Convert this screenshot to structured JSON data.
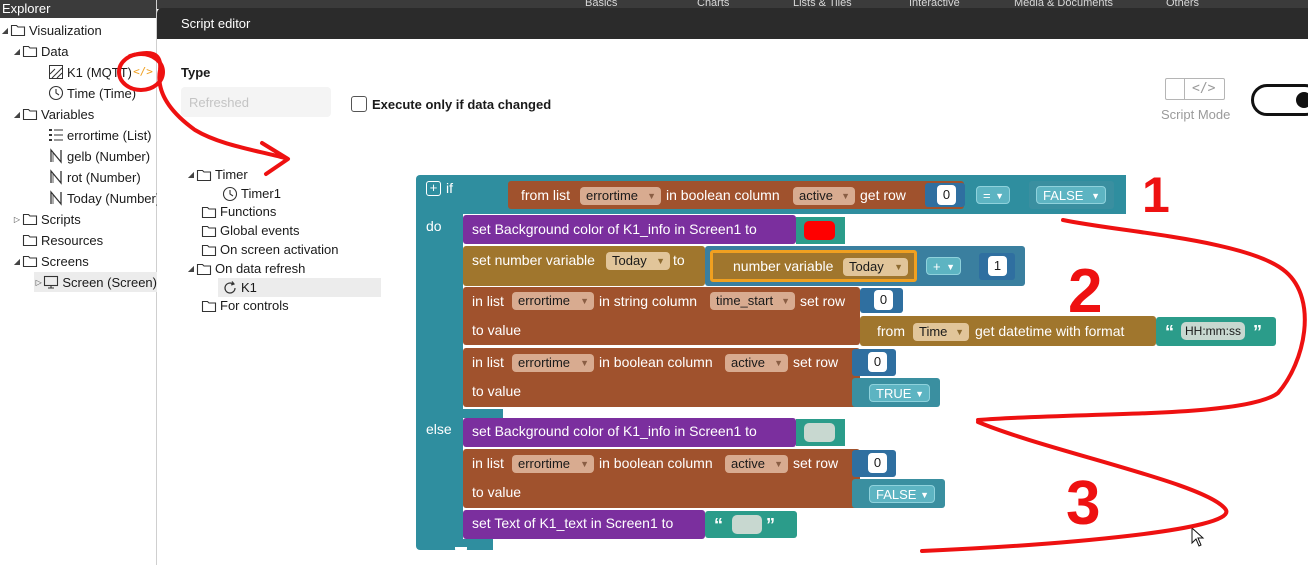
{
  "explorer": {
    "title": "Explorer",
    "items": [
      {
        "label": "Visualization"
      },
      {
        "label": "Data"
      },
      {
        "label": "K1 (MQTT)"
      },
      {
        "label": "Time (Time)"
      },
      {
        "label": "Variables"
      },
      {
        "label": "errortime (List)"
      },
      {
        "label": "gelb (Number)"
      },
      {
        "label": "rot (Number)"
      },
      {
        "label": "Today (Number)"
      },
      {
        "label": "Scripts"
      },
      {
        "label": "Resources"
      },
      {
        "label": "Screens"
      },
      {
        "label": "Screen (Screen)"
      }
    ]
  },
  "top_tabs": [
    "Basics",
    "Charts",
    "Lists & Tiles",
    "Interactive",
    "Media & Documents",
    "Others"
  ],
  "editor": {
    "title": "Script editor",
    "type_label": "Type",
    "type_value": "Refreshed",
    "checkbox_label": "Execute only if data changed",
    "checkbox_checked": false,
    "script_mode_label": "Script Mode",
    "script_mode_icon": "</>",
    "script_mode_on": true
  },
  "events": [
    {
      "label": "Timer"
    },
    {
      "label": "Timer1"
    },
    {
      "label": "Functions"
    },
    {
      "label": "Global events"
    },
    {
      "label": "On screen activation"
    },
    {
      "label": "On data refresh"
    },
    {
      "label": "K1"
    },
    {
      "label": "For controls"
    }
  ],
  "blocks": {
    "if_label": "if",
    "do_label": "do",
    "else_label": "else",
    "condition": {
      "from_list": "from list",
      "list": "errortime",
      "in_boolean_column": "in boolean column",
      "column": "active",
      "get_row": "get row",
      "row": "0",
      "operator": "=",
      "compare": "FALSE"
    },
    "do1": {
      "text": "set Background color of K1_info in Screen1 to",
      "color": "#ff0000"
    },
    "do2": {
      "prefix": "set number variable",
      "variable": "Today",
      "to": "to",
      "inner_prefix": "number variable",
      "inner_variable": "Today",
      "operator": "+",
      "amount": "1"
    },
    "do3": {
      "in_list": "in list",
      "list": "errortime",
      "in_string_column": "in string column",
      "column": "time_start",
      "set_row": "set row",
      "row": "0",
      "to_value": "to value",
      "from": "from",
      "source": "Time",
      "get_datetime": "get datetime with format",
      "format": "HH:mm:ss"
    },
    "do4": {
      "in_list": "in list",
      "list": "errortime",
      "in_boolean_column": "in boolean column",
      "column": "active",
      "set_row": "set row",
      "row": "0",
      "to_value": "to value",
      "value": "TRUE"
    },
    "else1": {
      "text": "set Background color of K1_info in Screen1 to",
      "color": "#c8d8d0"
    },
    "else2": {
      "in_list": "in list",
      "list": "errortime",
      "in_boolean_column": "in boolean column",
      "column": "active",
      "set_row": "set row",
      "row": "0",
      "to_value": "to value",
      "value": "FALSE"
    },
    "else3": {
      "text": "set Text of K1_text in Screen1 to",
      "value": ""
    }
  },
  "annotations": {
    "numbers": [
      "1",
      "2",
      "3"
    ],
    "color": "#ee1111"
  },
  "colors": {
    "control": "#2f8e9f",
    "list": "#a0522d",
    "action": "#7b2f9e",
    "variable": "#2f6fa0",
    "math": "#3a7f9f",
    "text": "#2b9c8a",
    "datetime": "#a0762d",
    "highlight": "#f0a020"
  },
  "icons": {
    "folder": "folder-icon",
    "chart": "chart-icon",
    "clock": "clock-icon",
    "list": "list-icon",
    "number": "number-icon",
    "monitor": "monitor-icon",
    "refresh": "refresh-icon",
    "code": "code-icon"
  }
}
